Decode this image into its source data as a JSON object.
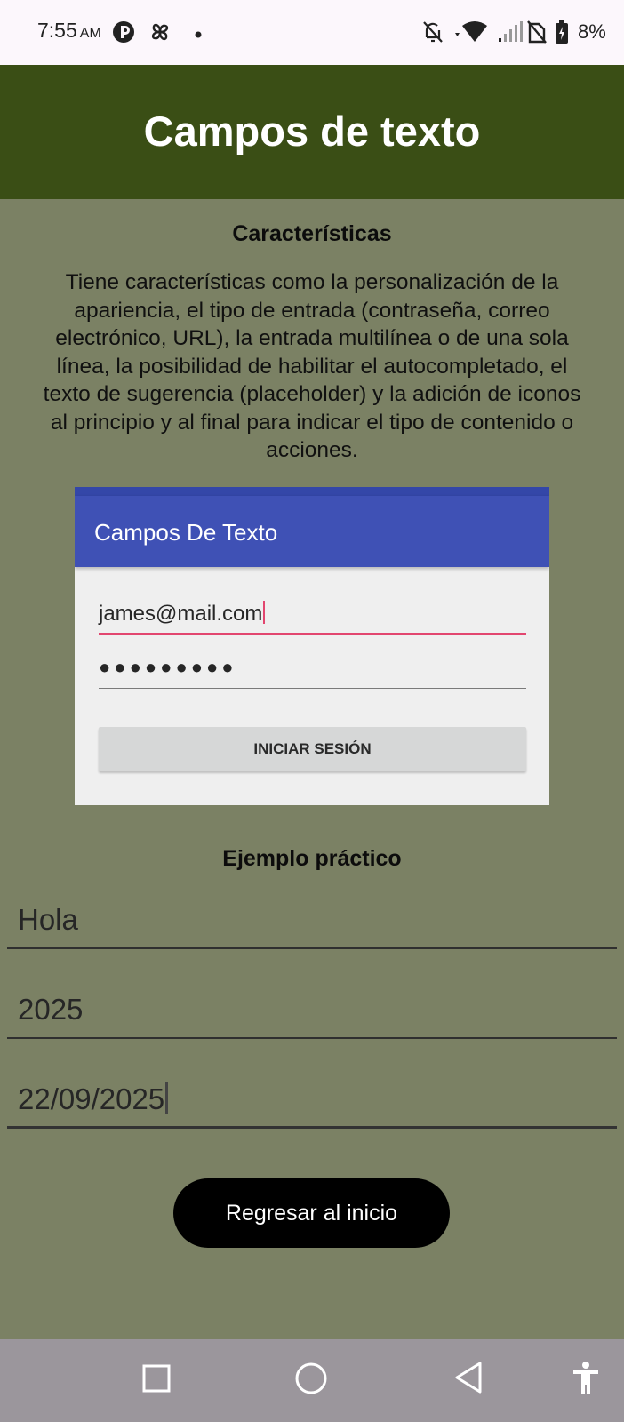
{
  "status_bar": {
    "time": "7:55",
    "ampm": "AM",
    "battery_percent": "8%",
    "icons": [
      "app-r-icon",
      "pinwheel-icon",
      "notification-dot-icon",
      "bell-off-icon",
      "wifi-icon",
      "signal-icon",
      "no-sim-icon",
      "battery-icon"
    ]
  },
  "app_bar": {
    "title": "Campos de texto",
    "color": "#3a4e15"
  },
  "features": {
    "heading": "Características",
    "description": "Tiene características como la personalización de la apariencia, el tipo de entrada (contraseña, correo electrónico, URL), la entrada multilínea o de una sola línea, la posibilidad de habilitar el autocompletado, el texto de sugerencia (placeholder) y la adición de iconos al principio y al final para indicar el tipo de contenido o acciones."
  },
  "example_image": {
    "app_title": "Campos De Texto",
    "email_value": "james@mail.com",
    "password_value": "●●●●●●●●●",
    "button_label": "INICIAR SESIÓN",
    "accent_color": "#3f51b5",
    "focus_color": "#e2466f"
  },
  "practical_example": {
    "heading": "Ejemplo práctico",
    "fields": [
      {
        "value": "Hola"
      },
      {
        "value": "2025"
      },
      {
        "value": "22/09/2025"
      }
    ]
  },
  "back_button": {
    "label": "Regresar al inicio"
  },
  "nav_bar": {
    "icons": [
      "recents-square-icon",
      "home-circle-icon",
      "back-triangle-icon",
      "accessibility-icon"
    ]
  },
  "colors": {
    "background": "#7b8164",
    "nav_bar": "#9b969c"
  }
}
